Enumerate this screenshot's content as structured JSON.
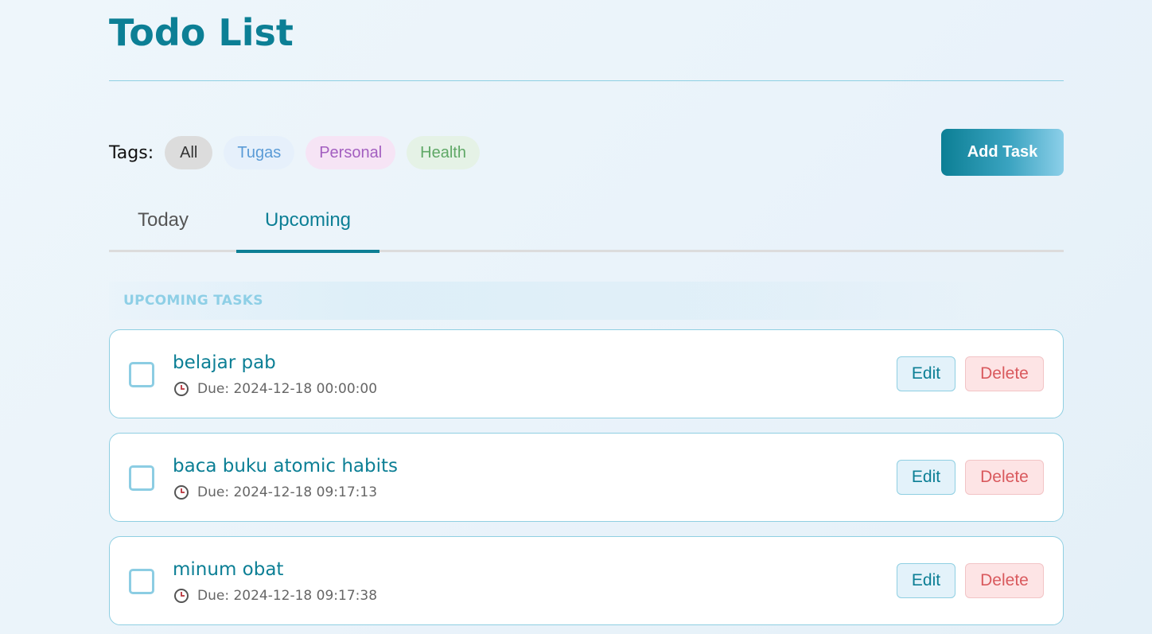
{
  "page": {
    "title": "Todo List"
  },
  "tags": {
    "label": "Tags:",
    "items": [
      {
        "label": "All",
        "color": "#333333",
        "bg": "#dcdcdc"
      },
      {
        "label": "Tugas",
        "color": "#5a9bd6",
        "bg": "#e6f0fb"
      },
      {
        "label": "Personal",
        "color": "#a35fc0",
        "bg": "#f6e4f5"
      },
      {
        "label": "Health",
        "color": "#5fa866",
        "bg": "#e5f2e6"
      }
    ],
    "selected": "All"
  },
  "toolbar": {
    "add_task_label": "Add Task"
  },
  "tabs": {
    "items": [
      {
        "label": "Today"
      },
      {
        "label": "Upcoming"
      }
    ],
    "active": "Upcoming"
  },
  "section": {
    "label": "UPCOMING TASKS"
  },
  "tasks": [
    {
      "title": "belajar pab",
      "due": "Due: 2024-12-18 00:00:00",
      "done": false,
      "edit_label": "Edit",
      "delete_label": "Delete"
    },
    {
      "title": "baca buku atomic habits",
      "due": "Due: 2024-12-18 09:17:13",
      "done": false,
      "edit_label": "Edit",
      "delete_label": "Delete"
    },
    {
      "title": "minum obat",
      "due": "Due: 2024-12-18 09:17:38",
      "done": false,
      "edit_label": "Edit",
      "delete_label": "Delete"
    }
  ],
  "icons": {
    "due": "clock-icon"
  },
  "colors": {
    "accent": "#0c7f95",
    "danger": "#d9595d",
    "border": "#8fcfe2"
  }
}
